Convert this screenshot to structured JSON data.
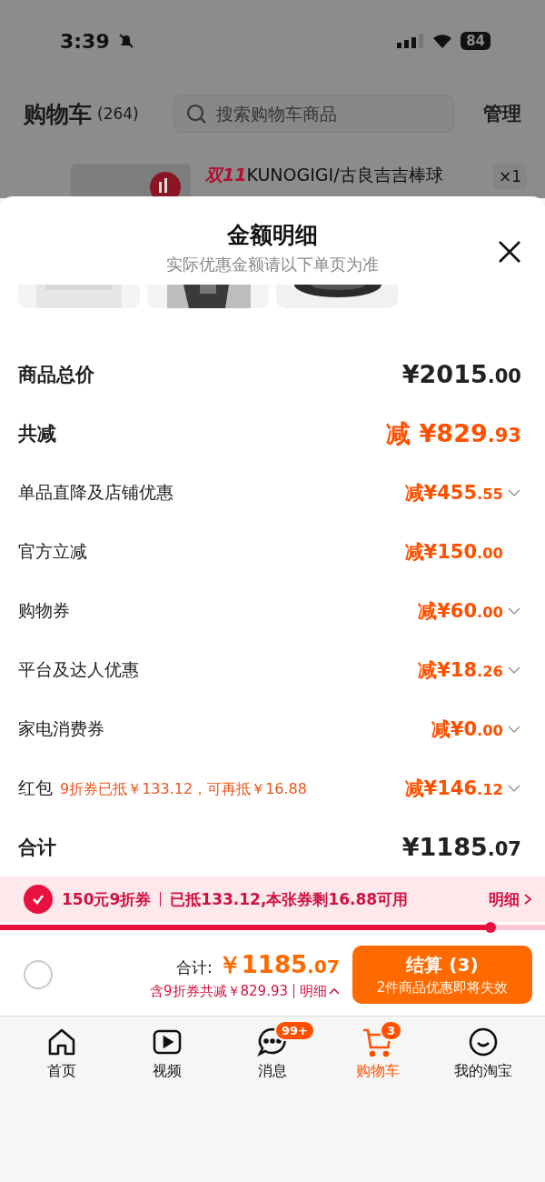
{
  "status_bar": {
    "time": "3:39",
    "battery": "84"
  },
  "header": {
    "title": "购物车",
    "count": "(264)",
    "search": {
      "placeholder": "搜索购物车商品"
    },
    "manage": "管理"
  },
  "product": {
    "tag": "双11",
    "title": "KUNOGIGI/古良吉吉棒球",
    "quantity": "×1"
  },
  "sheet": {
    "title": "金额明细",
    "subtitle": "实际优惠金额请以下单页为准",
    "rows": [
      {
        "kind": "total",
        "label": "商品总价",
        "amount": "¥2015.00"
      },
      {
        "kind": "reduction",
        "label": "共减",
        "amount": "减 ¥829.93"
      },
      {
        "kind": "item",
        "label": "单品直降及店铺优惠",
        "amount": "减¥455.55",
        "expandable": true
      },
      {
        "kind": "item",
        "label": "官方立减",
        "amount": "减¥150.00",
        "expandable": false
      },
      {
        "kind": "item",
        "label": "购物券",
        "amount": "减¥60.00",
        "expandable": true
      },
      {
        "kind": "item",
        "label": "平台及达人优惠",
        "amount": "减¥18.26",
        "expandable": true
      },
      {
        "kind": "item",
        "label": "家电消费券",
        "amount": "减¥0.00",
        "expandable": true
      },
      {
        "kind": "item",
        "label": "红包",
        "note": "9折券已抵￥133.12，可再抵￥16.88",
        "amount": "减¥146.12",
        "expandable": true
      },
      {
        "kind": "total",
        "label": "合计",
        "amount": "¥1185.07"
      }
    ]
  },
  "coupon": {
    "checked": true,
    "name": "150元9折券",
    "detail": "已抵133.12,本张券剩16.88可用",
    "link": "明细",
    "level": 0.9
  },
  "checkout": {
    "select_all": {
      "selected": false
    },
    "total_label": "合计:",
    "total": "￥1185.07",
    "saving": "含9折券共减￥829.93",
    "detail_link": "明细",
    "button": "结算 (3)",
    "button_note": "2件商品优惠即将失效"
  },
  "tabs": [
    {
      "kind": "home",
      "label": "首页",
      "selected": false
    },
    {
      "kind": "video",
      "label": "视频",
      "selected": false
    },
    {
      "kind": "message",
      "label": "消息",
      "badge": "99+",
      "selected": false
    },
    {
      "kind": "cart",
      "label": "购物车",
      "badge": "3",
      "selected": true
    },
    {
      "kind": "profile",
      "label": "我的淘宝",
      "selected": false
    }
  ]
}
